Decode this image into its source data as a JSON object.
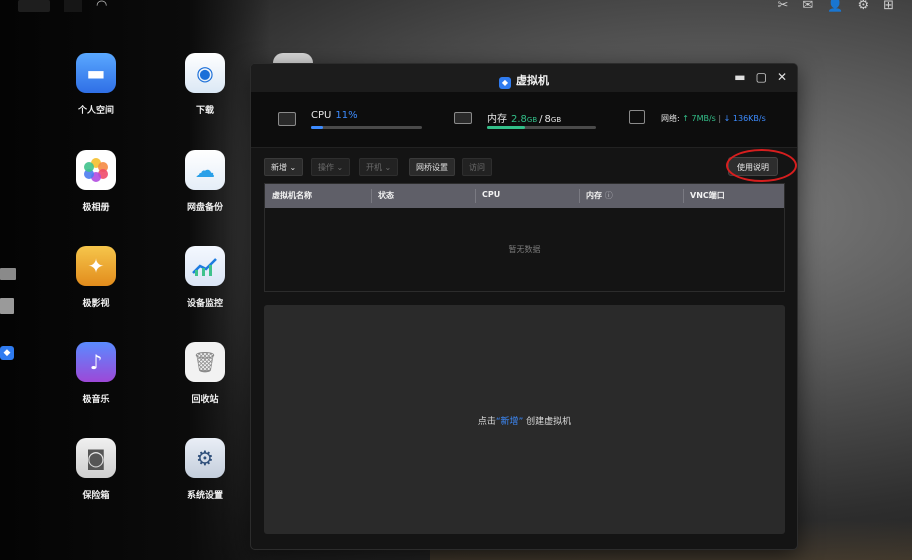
{
  "desktop": {
    "apps": [
      {
        "name": "personal-space",
        "label": "个人空间",
        "icon": "folder-icon"
      },
      {
        "name": "download",
        "label": "下载",
        "icon": "download-icon"
      },
      {
        "name": "photo-album",
        "label": "极相册",
        "icon": "photos-icon"
      },
      {
        "name": "cloud-backup",
        "label": "网盘备份",
        "icon": "cloud-upload-icon"
      },
      {
        "name": "video",
        "label": "极影视",
        "icon": "video-icon"
      },
      {
        "name": "device-monitor",
        "label": "设备监控",
        "icon": "chart-icon"
      },
      {
        "name": "music",
        "label": "极音乐",
        "icon": "music-icon"
      },
      {
        "name": "recycle-bin",
        "label": "回收站",
        "icon": "trash-icon"
      },
      {
        "name": "safe-box",
        "label": "保险箱",
        "icon": "safe-icon"
      },
      {
        "name": "system-settings",
        "label": "系统设置",
        "icon": "gear-icon"
      }
    ]
  },
  "window": {
    "title": "虚拟机",
    "stats": {
      "cpu_label": "CPU",
      "cpu_value": "11%",
      "cpu_fraction": 0.11,
      "mem_label": "内存",
      "mem_used": "2.8",
      "mem_used_unit": "GB",
      "mem_sep": "/",
      "mem_total": "8",
      "mem_total_unit": "GB",
      "mem_fraction": 0.35,
      "net_label": "网络:",
      "net_up": "↑ 7MB/s",
      "net_sep": "|",
      "net_down": "↓ 136KB/s"
    },
    "toolbar": {
      "new_label": "新增",
      "ops_label": "操作",
      "power_label": "开机",
      "bridge_label": "网桥设置",
      "access_label": "访问",
      "help_label": "使用说明"
    },
    "table": {
      "columns": [
        "虚拟机名称",
        "状态",
        "CPU",
        "内存",
        "VNC端口"
      ],
      "empty_text": "暂无数据"
    },
    "hint": {
      "prefix": "点击",
      "quote_open": "“",
      "link": "新增",
      "quote_close": "”",
      "suffix": "创建虚拟机"
    }
  },
  "colors": {
    "accent": "#3d8cff",
    "success": "#33c08a",
    "highlight_circle": "#d61e1e"
  }
}
